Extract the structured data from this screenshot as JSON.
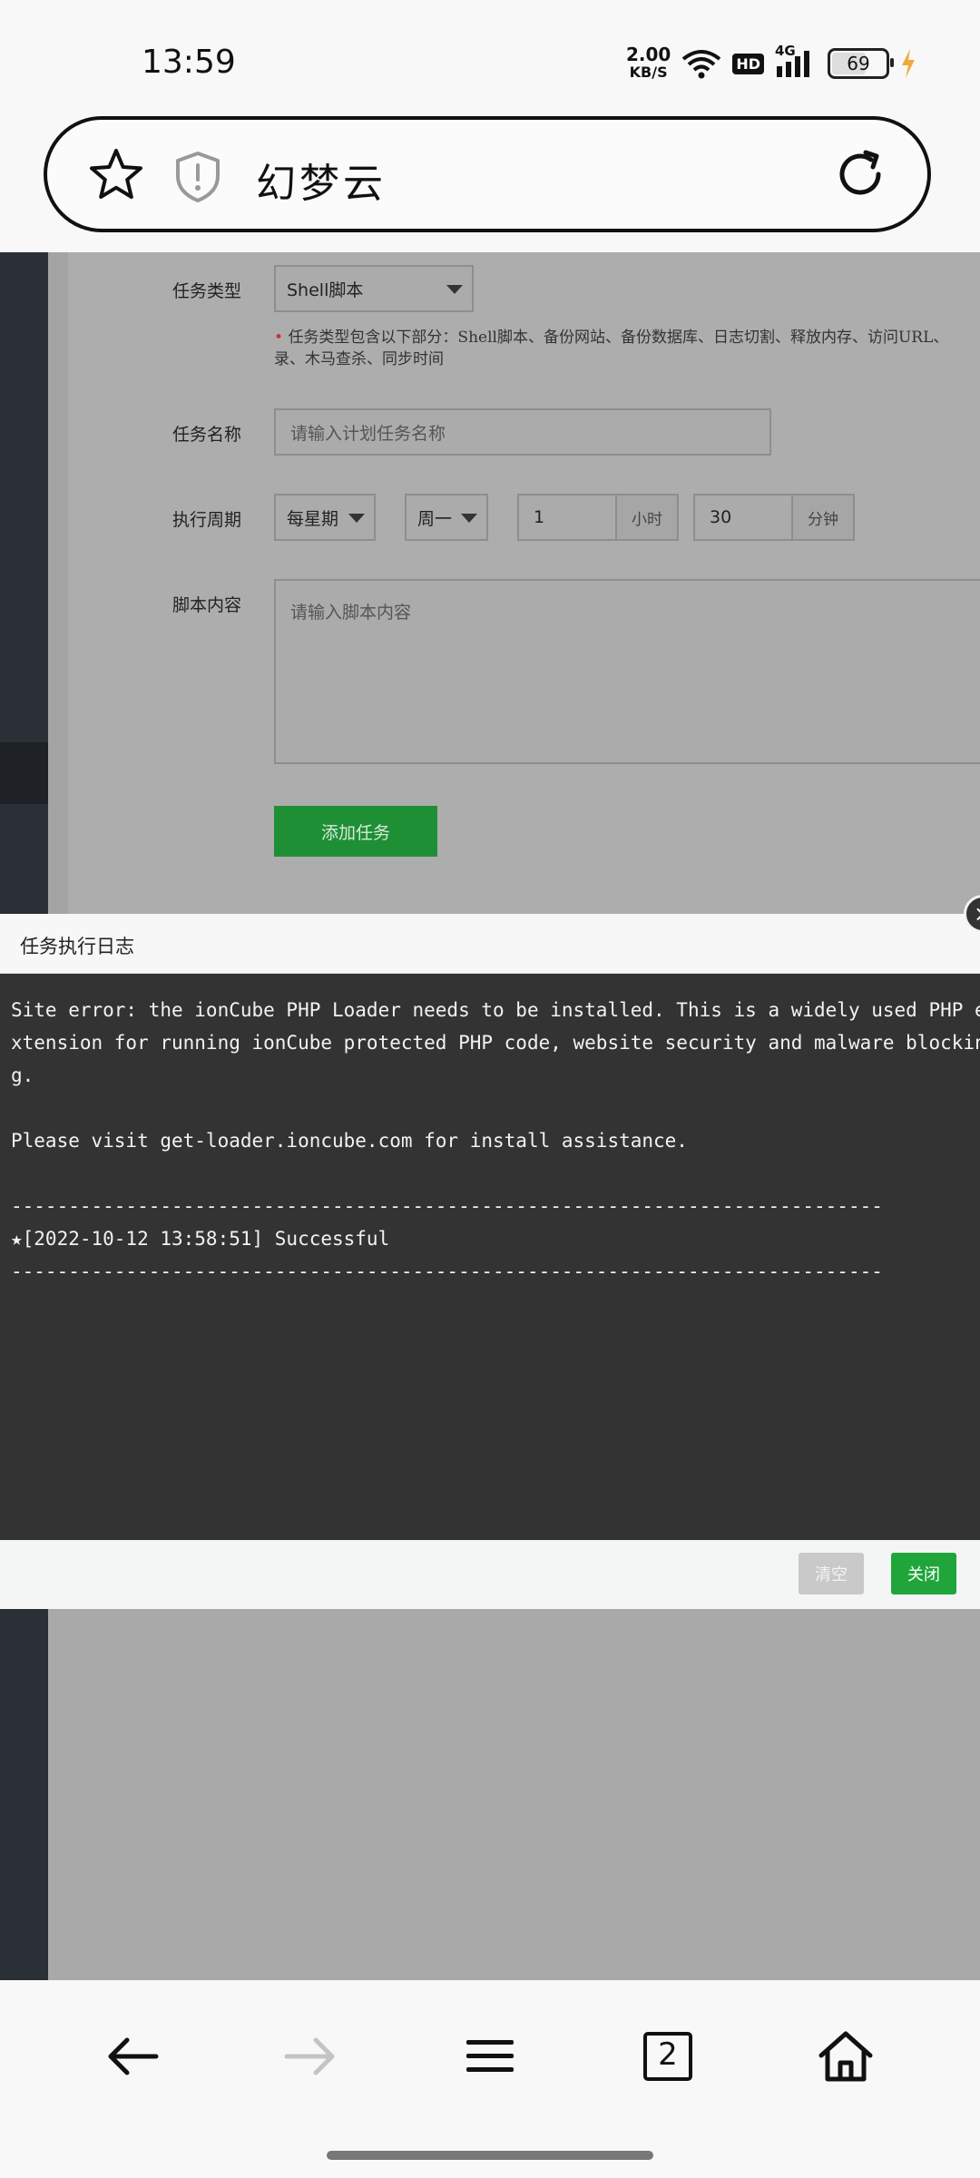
{
  "status_bar": {
    "time": "13:59",
    "net_speed_value": "2.00",
    "net_speed_unit": "KB/S",
    "hd_label": "HD",
    "network_type": "4G",
    "battery_level": "69",
    "battery_fraction": 0.69
  },
  "browser": {
    "site_title": "幻梦云",
    "tab_count": "2"
  },
  "form": {
    "task_type_label": "任务类型",
    "task_type_value": "Shell脚本",
    "task_type_hint": "任务类型包含以下部分：Shell脚本、备份网站、备份数据库、日志切割、释放内存、访问URL、",
    "task_type_hint_line2": "录、木马查杀、同步时间",
    "task_name_label": "任务名称",
    "task_name_placeholder": "请输入计划任务名称",
    "cycle_label": "执行周期",
    "cycle_value": "每星期",
    "weekday_value": "周一",
    "hour_value": "1",
    "hour_unit": "小时",
    "minute_value": "30",
    "minute_unit": "分钟",
    "script_label": "脚本内容",
    "script_placeholder": "请输入脚本内容",
    "add_button": "添加任务"
  },
  "modal": {
    "title": "任务执行日志",
    "close_symbol": "×",
    "log_lines": [
      "Site error: the ionCube PHP Loader needs to be installed. This is a widely used PHP e",
      "xtension for running ionCube protected PHP code, website security and malware blockin",
      "g.",
      "Please visit get-loader.ioncube.com for install assistance.",
      "----------------------------------------------------------------------------",
      "★[2022-10-12 13:58:51] Successful",
      "----------------------------------------------------------------------------"
    ],
    "clear_button": "清空",
    "close_button": "关闭"
  },
  "colors": {
    "accent_green": "#20a53a",
    "log_background": "#333333"
  },
  "icons": {
    "bookmark": "star-icon",
    "security": "shield-icon",
    "reload": "reload-icon",
    "back": "back-arrow-icon",
    "forward": "forward-arrow-icon",
    "menu": "menu-icon",
    "tabs": "tabs-icon",
    "home": "home-icon"
  }
}
